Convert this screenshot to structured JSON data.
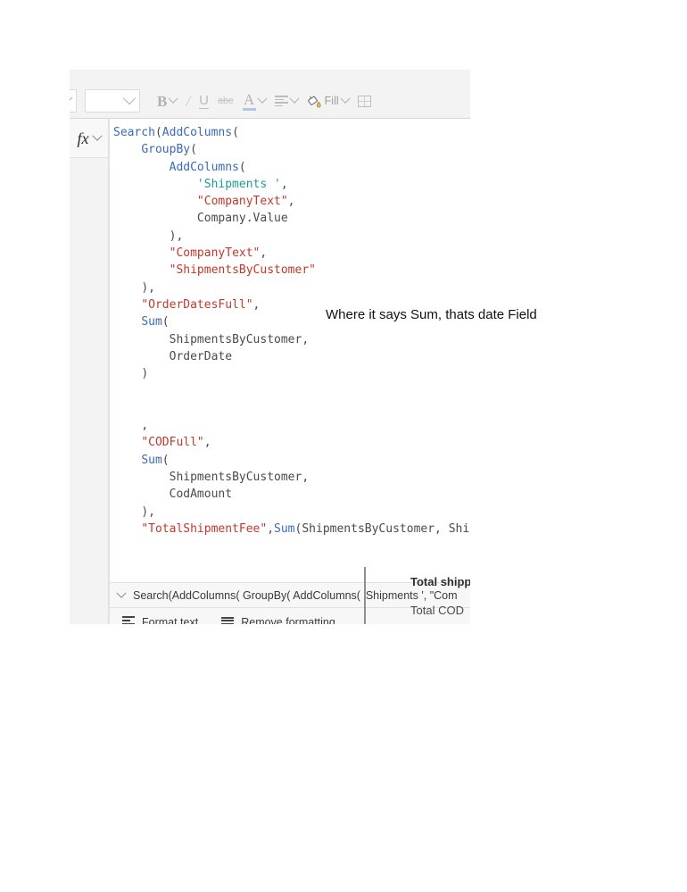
{
  "toolbar": {
    "font_combo_value": "",
    "size_combo_value": "",
    "bold_label": "B",
    "italic_label": "/",
    "underline_label": "U",
    "strikethrough_label": "abc",
    "font_color_label": "A",
    "fill_label": "Fill"
  },
  "formula": {
    "fx_label": "fx",
    "lines": [
      [
        {
          "t": "Search",
          "c": "fn"
        },
        {
          "t": "(",
          "c": "p"
        },
        {
          "t": "AddColumns",
          "c": "fn"
        },
        {
          "t": "(",
          "c": "p"
        }
      ],
      [
        {
          "t": "    ",
          "c": "p"
        },
        {
          "t": "GroupBy",
          "c": "fn"
        },
        {
          "t": "(",
          "c": "p"
        }
      ],
      [
        {
          "t": "        ",
          "c": "p"
        },
        {
          "t": "AddColumns",
          "c": "fn"
        },
        {
          "t": "(",
          "c": "p"
        }
      ],
      [
        {
          "t": "            ",
          "c": "p"
        },
        {
          "t": "'Shipments '",
          "c": "sq"
        },
        {
          "t": ",",
          "c": "p"
        }
      ],
      [
        {
          "t": "            ",
          "c": "p"
        },
        {
          "t": "\"CompanyText\"",
          "c": "str"
        },
        {
          "t": ",",
          "c": "p"
        }
      ],
      [
        {
          "t": "            ",
          "c": "p"
        },
        {
          "t": "Company.Value",
          "c": "id"
        }
      ],
      [
        {
          "t": "        ",
          "c": "p"
        },
        {
          "t": "),",
          "c": "p"
        }
      ],
      [
        {
          "t": "        ",
          "c": "p"
        },
        {
          "t": "\"CompanyText\"",
          "c": "str"
        },
        {
          "t": ",",
          "c": "p"
        }
      ],
      [
        {
          "t": "        ",
          "c": "p"
        },
        {
          "t": "\"ShipmentsByCustomer\"",
          "c": "str"
        }
      ],
      [
        {
          "t": "    ",
          "c": "p"
        },
        {
          "t": "),",
          "c": "p"
        }
      ],
      [
        {
          "t": "    ",
          "c": "p"
        },
        {
          "t": "\"OrderDatesFull\"",
          "c": "str"
        },
        {
          "t": ",",
          "c": "p"
        }
      ],
      [
        {
          "t": "    ",
          "c": "p"
        },
        {
          "t": "Sum",
          "c": "fn"
        },
        {
          "t": "(",
          "c": "p"
        }
      ],
      [
        {
          "t": "        ",
          "c": "p"
        },
        {
          "t": "ShipmentsByCustomer",
          "c": "id"
        },
        {
          "t": ",",
          "c": "p"
        }
      ],
      [
        {
          "t": "        ",
          "c": "p"
        },
        {
          "t": "OrderDate",
          "c": "id"
        }
      ],
      [
        {
          "t": "    ",
          "c": "p"
        },
        {
          "t": ")",
          "c": "p"
        }
      ],
      [],
      [],
      [
        {
          "t": "    ",
          "c": "p"
        },
        {
          "t": ",",
          "c": "p"
        }
      ],
      [
        {
          "t": "    ",
          "c": "p"
        },
        {
          "t": "\"CODFull\"",
          "c": "str"
        },
        {
          "t": ",",
          "c": "p"
        }
      ],
      [
        {
          "t": "    ",
          "c": "p"
        },
        {
          "t": "Sum",
          "c": "fn"
        },
        {
          "t": "(",
          "c": "p"
        }
      ],
      [
        {
          "t": "        ",
          "c": "p"
        },
        {
          "t": "ShipmentsByCustomer",
          "c": "id"
        },
        {
          "t": ",",
          "c": "p"
        }
      ],
      [
        {
          "t": "        ",
          "c": "p"
        },
        {
          "t": "CodAmount",
          "c": "id"
        }
      ],
      [
        {
          "t": "    ",
          "c": "p"
        },
        {
          "t": "),",
          "c": "p"
        }
      ],
      [
        {
          "t": "    ",
          "c": "p"
        },
        {
          "t": "\"TotalShipmentFee\"",
          "c": "str"
        },
        {
          "t": ",",
          "c": "p"
        },
        {
          "t": "Sum",
          "c": "fn"
        },
        {
          "t": "(",
          "c": "p"
        },
        {
          "t": "ShipmentsByCustomer, Shi",
          "c": "id"
        }
      ]
    ],
    "collapsed_text": "Search(AddColumns( GroupBy( AddColumns( 'Shipments ', \"Com"
  },
  "actions": {
    "format_text_label": "Format text",
    "remove_formatting_label": "Remove formatting"
  },
  "annotation": {
    "text": "Where it says Sum, thats date Field"
  },
  "side_labels": {
    "total_shipping": "Total shipp",
    "total_cod": "Total COD"
  },
  "colors": {
    "function": "#3b6ab8",
    "string": "#c0392b",
    "single_quoted": "#1f9b8e",
    "identifier": "#4a4a4a",
    "panel_background": "#e2e2e2",
    "toolbar_background": "#f3f3f3"
  }
}
